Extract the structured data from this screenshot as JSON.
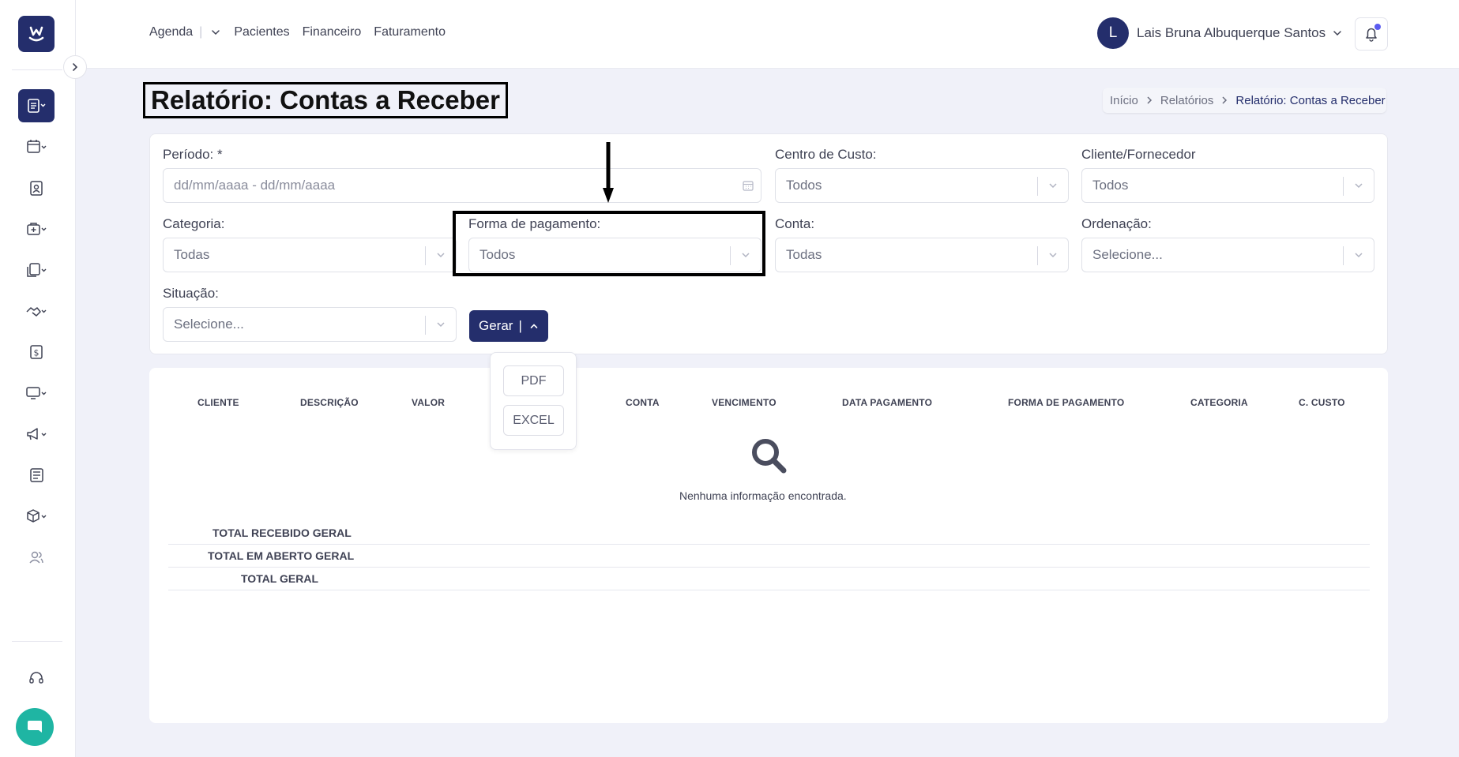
{
  "app": {
    "logo_icon": "brand-logo-icon",
    "accent_color": "#242e6c",
    "fab_color": "#1fb5a3"
  },
  "nav": {
    "items": [
      {
        "label": "Agenda"
      },
      {
        "label": "Pacientes"
      },
      {
        "label": "Financeiro"
      },
      {
        "label": "Faturamento"
      }
    ]
  },
  "user": {
    "initial": "L",
    "name": "Lais Bruna Albuquerque Santos"
  },
  "sidebar": {
    "icons": [
      "reports-icon",
      "calendar-icon",
      "patient-badge-icon",
      "medical-case-icon",
      "documents-icon",
      "handshake-icon",
      "dollar-icon",
      "monitor-icon",
      "megaphone-icon",
      "newspaper-icon",
      "box-icon",
      "users-icon",
      "headset-icon"
    ]
  },
  "page": {
    "title": "Relatório: Contas a Receber"
  },
  "breadcrumb": {
    "items": [
      "Início",
      "Relatórios",
      "Relatório: Contas a Receber"
    ]
  },
  "filters": {
    "periodo": {
      "label": "Período: *",
      "placeholder": "dd/mm/aaaa - dd/mm/aaaa"
    },
    "centro_custo": {
      "label": "Centro de Custo:",
      "value": "Todos"
    },
    "cliente_fornecedor": {
      "label": "Cliente/Fornecedor",
      "value": "Todos"
    },
    "categoria": {
      "label": "Categoria:",
      "value": "Todas"
    },
    "forma_pagamento": {
      "label": "Forma de pagamento:",
      "value": "Todos"
    },
    "conta": {
      "label": "Conta:",
      "value": "Todas"
    },
    "ordenacao": {
      "label": "Ordenação:",
      "value": "Selecione..."
    },
    "situacao": {
      "label": "Situação:",
      "value": "Selecione..."
    }
  },
  "actions": {
    "gerar_label": "Gerar",
    "export_options": [
      "PDF",
      "EXCEL"
    ]
  },
  "table": {
    "headers": [
      "CLIENTE",
      "DESCRIÇÃO",
      "VALOR",
      "CONTA",
      "VENCIMENTO",
      "DATA PAGAMENTO",
      "FORMA DE PAGAMENTO",
      "CATEGORIA",
      "C. CUSTO"
    ],
    "empty_message": "Nenhuma informação encontrada.",
    "totals": [
      "TOTAL RECEBIDO GERAL",
      "TOTAL EM ABERTO GERAL",
      "TOTAL GERAL"
    ]
  }
}
